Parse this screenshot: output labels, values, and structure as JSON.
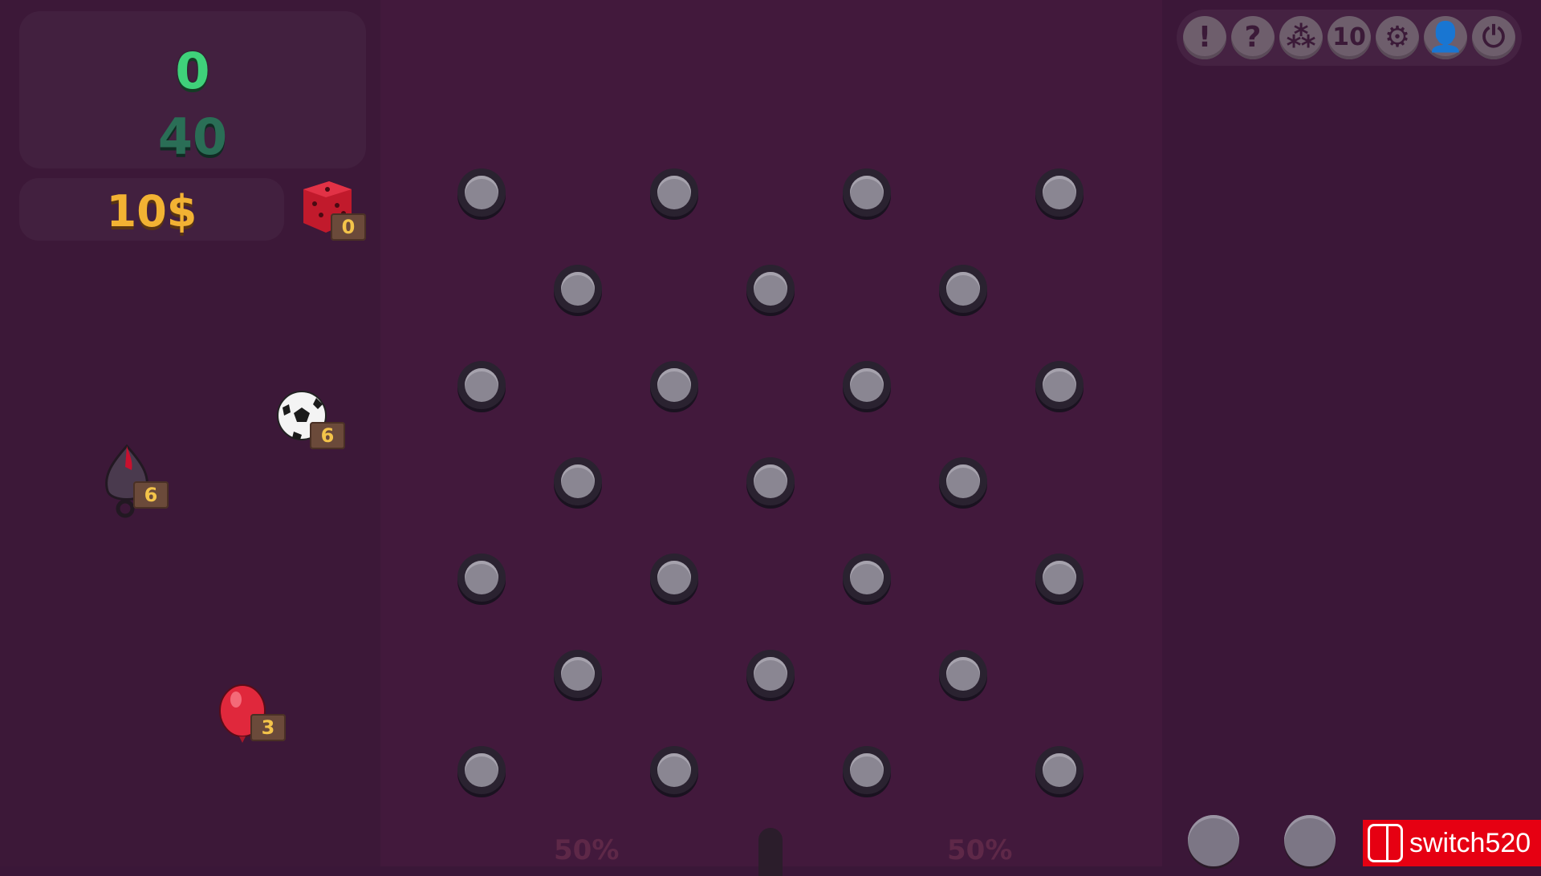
{
  "score": {
    "current": "0",
    "target": "40"
  },
  "money": "10$",
  "items": [
    {
      "name": "dice",
      "count": "0",
      "icon": "red-dice-icon"
    },
    {
      "name": "soccer-ball",
      "count": "6",
      "icon": "soccer-ball-icon"
    },
    {
      "name": "bomb",
      "count": "6",
      "icon": "bomb-icon"
    },
    {
      "name": "balloon",
      "count": "3",
      "icon": "red-balloon-icon"
    }
  ],
  "toolbar": [
    {
      "name": "alert",
      "glyph": "!"
    },
    {
      "name": "help",
      "glyph": "?"
    },
    {
      "name": "balls",
      "glyph": "⁂"
    },
    {
      "name": "count",
      "glyph": "10"
    },
    {
      "name": "settings",
      "glyph": "⚙"
    },
    {
      "name": "profile",
      "glyph": "👤"
    },
    {
      "name": "power",
      "glyph": "⏻"
    }
  ],
  "odds": {
    "left": "50%",
    "right": "50%"
  },
  "watermark": "switch520",
  "colors": {
    "score_green": "#3fd17a",
    "target_green": "#2a6e56",
    "money_gold": "#f2b233",
    "board_bg": "#42193c"
  }
}
